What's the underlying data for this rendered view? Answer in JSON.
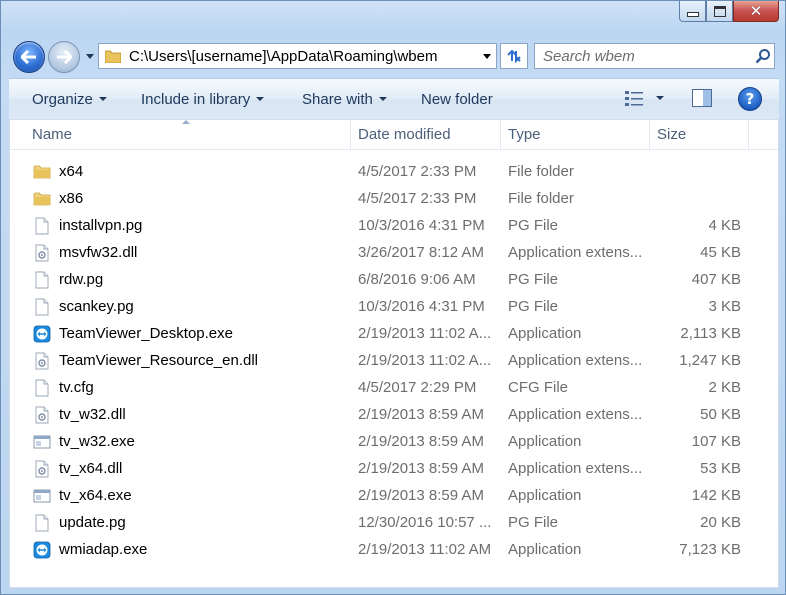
{
  "window": {
    "caption": {
      "minimize": "minimize-icon",
      "maximize": "maximize-icon",
      "close": "close-icon"
    }
  },
  "nav": {
    "address": "C:\\Users\\[username]\\AppData\\Roaming\\wbem",
    "search_placeholder": "Search wbem"
  },
  "toolbar": {
    "organize": "Organize",
    "include": "Include in library",
    "share": "Share with",
    "new_folder": "New folder",
    "help": "?"
  },
  "columns": {
    "name": "Name",
    "date": "Date modified",
    "type": "Type",
    "size": "Size"
  },
  "files": [
    {
      "icon": "folder",
      "name": "x64",
      "date": "4/5/2017 2:33 PM",
      "type": "File folder",
      "size": ""
    },
    {
      "icon": "folder",
      "name": "x86",
      "date": "4/5/2017 2:33 PM",
      "type": "File folder",
      "size": ""
    },
    {
      "icon": "file",
      "name": "installvpn.pg",
      "date": "10/3/2016 4:31 PM",
      "type": "PG File",
      "size": "4 KB"
    },
    {
      "icon": "dll",
      "name": "msvfw32.dll",
      "date": "3/26/2017 8:12 AM",
      "type": "Application extens...",
      "size": "45 KB"
    },
    {
      "icon": "file",
      "name": "rdw.pg",
      "date": "6/8/2016 9:06 AM",
      "type": "PG File",
      "size": "407 KB"
    },
    {
      "icon": "file",
      "name": "scankey.pg",
      "date": "10/3/2016 4:31 PM",
      "type": "PG File",
      "size": "3 KB"
    },
    {
      "icon": "teamviewer",
      "name": "TeamViewer_Desktop.exe",
      "date": "2/19/2013 11:02 A...",
      "type": "Application",
      "size": "2,113 KB"
    },
    {
      "icon": "dll",
      "name": "TeamViewer_Resource_en.dll",
      "date": "2/19/2013 11:02 A...",
      "type": "Application extens...",
      "size": "1,247 KB"
    },
    {
      "icon": "file",
      "name": "tv.cfg",
      "date": "4/5/2017 2:29 PM",
      "type": "CFG File",
      "size": "2 KB"
    },
    {
      "icon": "dll",
      "name": "tv_w32.dll",
      "date": "2/19/2013 8:59 AM",
      "type": "Application extens...",
      "size": "50 KB"
    },
    {
      "icon": "exe",
      "name": "tv_w32.exe",
      "date": "2/19/2013 8:59 AM",
      "type": "Application",
      "size": "107 KB"
    },
    {
      "icon": "dll",
      "name": "tv_x64.dll",
      "date": "2/19/2013 8:59 AM",
      "type": "Application extens...",
      "size": "53 KB"
    },
    {
      "icon": "exe",
      "name": "tv_x64.exe",
      "date": "2/19/2013 8:59 AM",
      "type": "Application",
      "size": "142 KB"
    },
    {
      "icon": "file",
      "name": "update.pg",
      "date": "12/30/2016 10:57 ...",
      "type": "PG File",
      "size": "20 KB"
    },
    {
      "icon": "teamviewer",
      "name": "wmiadap.exe",
      "date": "2/19/2013 11:02 AM",
      "type": "Application",
      "size": "7,123 KB"
    }
  ]
}
